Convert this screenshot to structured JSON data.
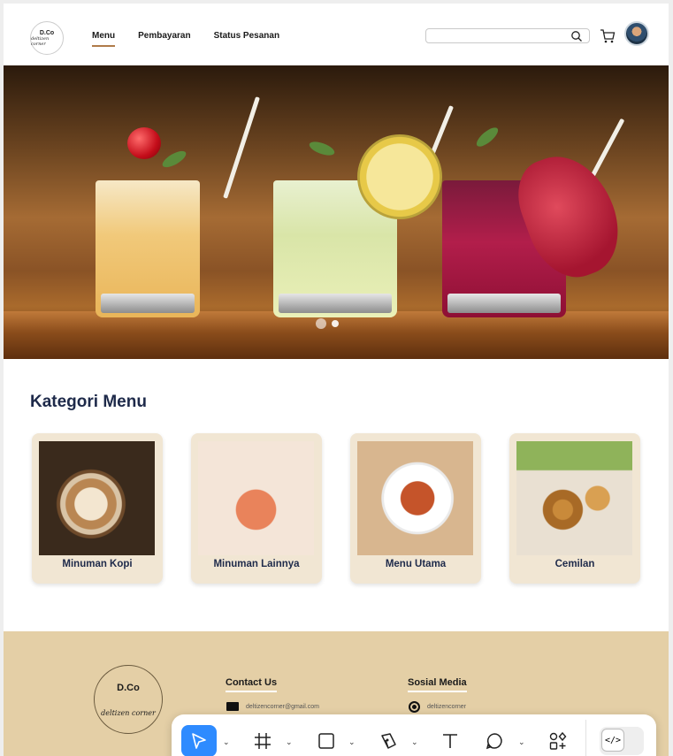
{
  "header": {
    "logo": {
      "title": "D.Co",
      "script": "deltizen corner"
    },
    "nav": [
      "Menu",
      "Pembayaran",
      "Status Pesanan"
    ],
    "active_nav": "Menu",
    "search_placeholder": ""
  },
  "hero": {
    "slides": 2,
    "active_slide": 1
  },
  "kategori": {
    "title": "Kategori Menu",
    "items": [
      {
        "label": "Minuman Kopi"
      },
      {
        "label": "Minuman Lainnya"
      },
      {
        "label": "Menu Utama"
      },
      {
        "label": "Cemilan"
      }
    ]
  },
  "footer": {
    "logo": {
      "title": "D.Co",
      "script": "deltizen corner"
    },
    "contact": {
      "title": "Contact Us",
      "email": "deltizencorner@gmail.com"
    },
    "social": {
      "title": "Sosial Media",
      "instagram": "deltizencorner"
    }
  },
  "toolbar": {
    "tools": [
      "move-tool",
      "frame-tool",
      "rectangle-tool",
      "pen-tool",
      "text-tool",
      "comment-tool",
      "actions-tool",
      "dev-mode-toggle"
    ],
    "selected": "move-tool",
    "accent": "#2e8bff"
  }
}
